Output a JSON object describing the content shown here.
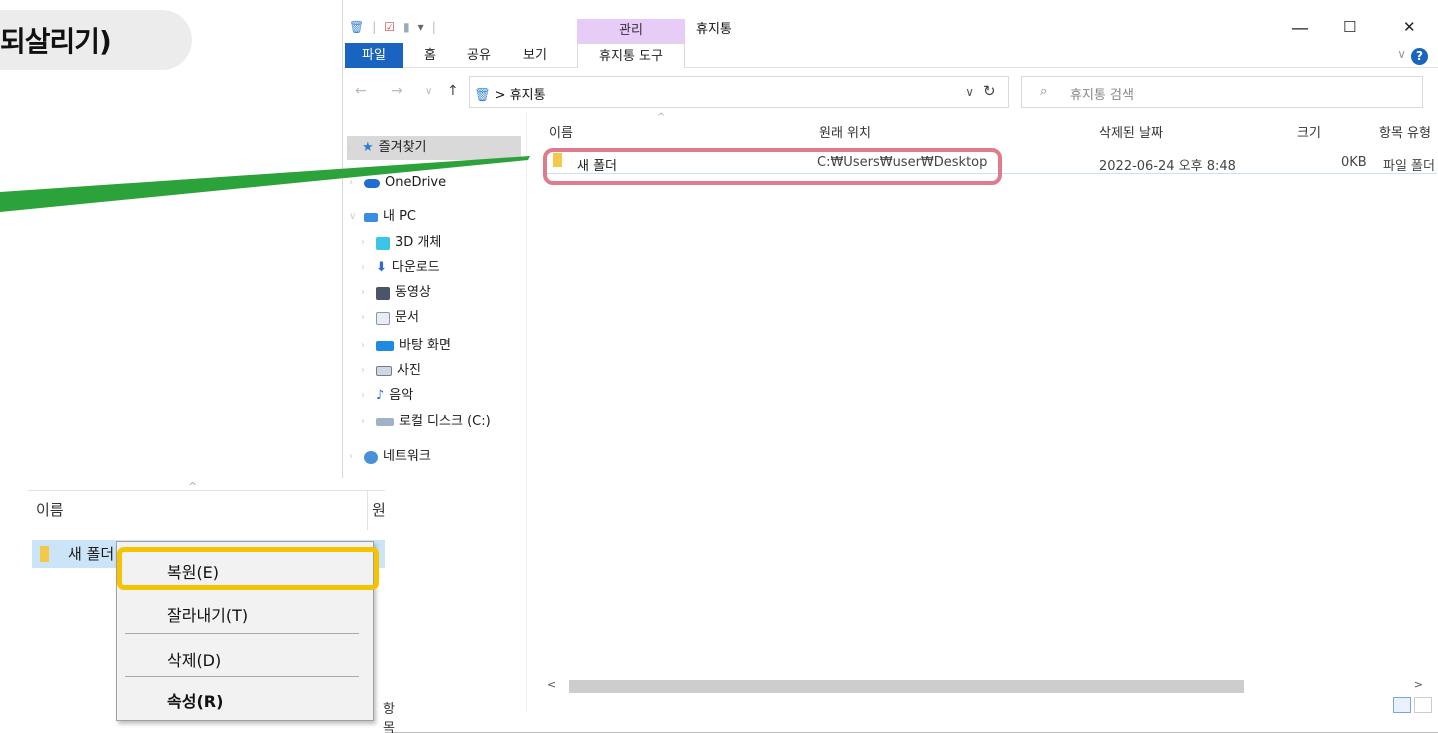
{
  "heading": "되살리기)",
  "window": {
    "title": "휴지통",
    "manage_tab": "관리",
    "ribbon_tabs": [
      "파일",
      "홈",
      "공유",
      "보기",
      "휴지통 도구"
    ],
    "help": "?",
    "min": "—",
    "max": "☐",
    "close": "✕"
  },
  "address": {
    "crumb": "휴지통",
    "search_placeholder": "휴지통 검색"
  },
  "nav": {
    "quick": "즐겨찾기",
    "onedrive": "OneDrive",
    "pc": "내 PC",
    "items": [
      "3D 개체",
      "다운로드",
      "동영상",
      "문서",
      "바탕 화면",
      "사진",
      "음악",
      "로컬 디스크 (C:)"
    ],
    "network": "네트워크"
  },
  "columns": {
    "name": "이름",
    "origin": "원래 위치",
    "deleted": "삭제된 날짜",
    "size": "크기",
    "type": "항목 유형"
  },
  "file": {
    "name": "새 폴더",
    "origin": "C:₩Users₩user₩Desktop",
    "deleted": "2022-06-24 오후 8:48",
    "size": "0KB",
    "type": "파일 폴더"
  },
  "inset": {
    "name_header": "이름",
    "orig_header": "원",
    "row_name": "새 폴더",
    "footer": "항목"
  },
  "context_menu": {
    "restore": "복원(E)",
    "cut": "잘라내기(T)",
    "delete": "삭제(D)",
    "properties": "속성(R)"
  },
  "colors": {
    "highlight_red": "#e07b8e",
    "highlight_yellow": "#f5c400",
    "arrow_green": "#2ba33a"
  }
}
